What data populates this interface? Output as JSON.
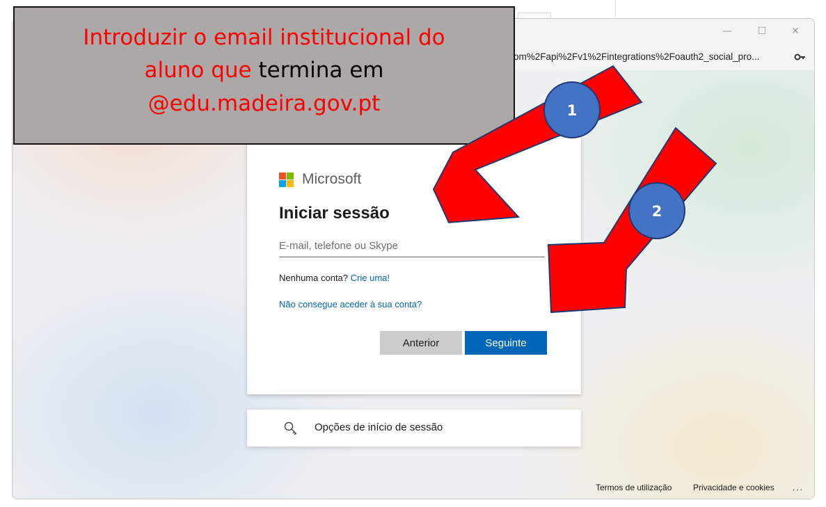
{
  "browser": {
    "url_fragment": "om%2Fapi%2Fv1%2Fintegrations%2Foauth2_social_pro...",
    "minimize_icon": "minimize-icon",
    "maximize_icon": "maximize-icon",
    "close_icon": "close-icon",
    "key_icon": "key-icon"
  },
  "signin": {
    "brand": "Microsoft",
    "title": "Iniciar sessão",
    "email_placeholder": "E-mail, telefone ou Skype",
    "no_account_text": "Nenhuma conta?",
    "create_link": "Crie uma!",
    "cant_access_link": "Não consegue aceder à sua conta?",
    "back_button": "Anterior",
    "next_button": "Seguinte",
    "brand_colors": [
      "#f25022",
      "#7fba00",
      "#00a4ef",
      "#ffb900"
    ]
  },
  "options": {
    "label": "Opções de início de sessão",
    "icon": "key-search-icon"
  },
  "footer": {
    "terms": "Termos de utilização",
    "privacy": "Privacidade e cookies",
    "more": "..."
  },
  "annotation": {
    "line1": "Introduzir o email institucional do",
    "line2_red": "aluno que",
    "line2_black": "termina em",
    "line3": "@edu.madeira.gov.pt",
    "badge1": "1",
    "badge2": "2",
    "arrow_color": "#ff0000",
    "badge_color": "#4472c4"
  }
}
